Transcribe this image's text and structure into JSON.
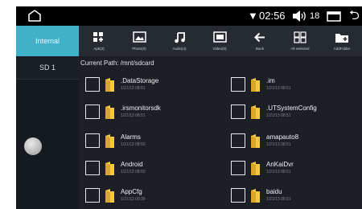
{
  "status_bar": {
    "time": "02:56",
    "volume": "18"
  },
  "sidebar": {
    "tabs": [
      {
        "label": "Internal",
        "selected": true
      },
      {
        "label": "SD 1",
        "selected": false
      }
    ]
  },
  "toolbar": {
    "items": [
      {
        "label": "Apk(2)",
        "icon": "apps-grid-icon"
      },
      {
        "label": "Photo(0)",
        "icon": "photo-icon"
      },
      {
        "label": "Audio(4)",
        "icon": "music-note-icon"
      },
      {
        "label": "Video(0)",
        "icon": "video-icon"
      },
      {
        "label": "Back",
        "icon": "arrow-left-icon"
      },
      {
        "label": "All selected",
        "icon": "select-all-icon"
      },
      {
        "label": "AddFolder",
        "icon": "add-folder-icon"
      }
    ]
  },
  "path": {
    "label": "Current Path: /mnt/sdcard"
  },
  "files": [
    {
      "name": ".DataStorage",
      "date": "1/21/13 08:51"
    },
    {
      "name": ".im",
      "date": "1/21/13 08:51"
    },
    {
      "name": ".irsmonitorsdk",
      "date": "1/21/13 08:51"
    },
    {
      "name": ".UTSystemConfig",
      "date": "1/21/13 08:51"
    },
    {
      "name": "Alarms",
      "date": "1/21/13 08:50"
    },
    {
      "name": "amapauto8",
      "date": "1/21/13 08:51"
    },
    {
      "name": "Android",
      "date": "1/21/13 08:50"
    },
    {
      "name": "AnKaiDvr",
      "date": "1/21/13 08:51"
    },
    {
      "name": "AppCfg",
      "date": "1/21/13 09:39"
    },
    {
      "name": "baidu",
      "date": "1/21/13 08:51"
    }
  ],
  "colors": {
    "accent": "#3fb2c8",
    "background": "#1c2026",
    "folder": "#f2c744"
  }
}
